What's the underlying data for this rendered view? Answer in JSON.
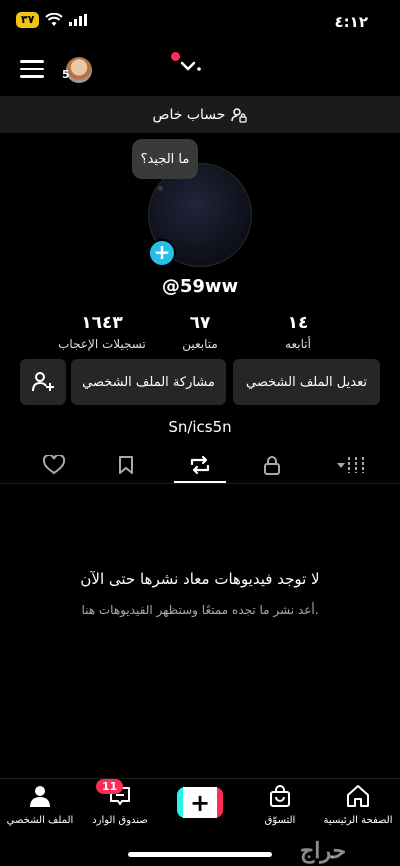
{
  "status_bar": {
    "time": "٤:١٢",
    "battery": "٣٧"
  },
  "header": {
    "avatar_count": "5",
    "account_chevron": "⌄"
  },
  "private_account": {
    "label": "حساب خاص"
  },
  "profile": {
    "bubble_text": "ما الجيد؟",
    "username": "@59ww",
    "link": "Sn/ics5n"
  },
  "stats": {
    "following": {
      "value": "١٤",
      "label": "أتابعه"
    },
    "followers": {
      "value": "٦٧",
      "label": "متابعين"
    },
    "likes": {
      "value": "١٦٤٣",
      "label": "تسجيلات الإعجاب"
    }
  },
  "buttons": {
    "edit_profile": "تعديل الملف الشخصي",
    "share_profile": "مشاركة الملف الشخصي"
  },
  "empty_state": {
    "title": "لا توجد فيديوهات معاد نشرها حتى الآن",
    "subtitle": "أعد نشر ما تجده ممتعًا وستظهر الفيديوهات هنا."
  },
  "bottom_nav": {
    "home": "الصفحة الرئيسية",
    "shop": "التسوّق",
    "inbox": "صندوق الوارد",
    "inbox_badge": "11",
    "profile": "الملف الشخصي"
  },
  "watermark": "حراج",
  "colors": {
    "accent_cyan": "#25c0e6",
    "accent_red": "#fe2c55",
    "battery": "#f1c40f"
  }
}
